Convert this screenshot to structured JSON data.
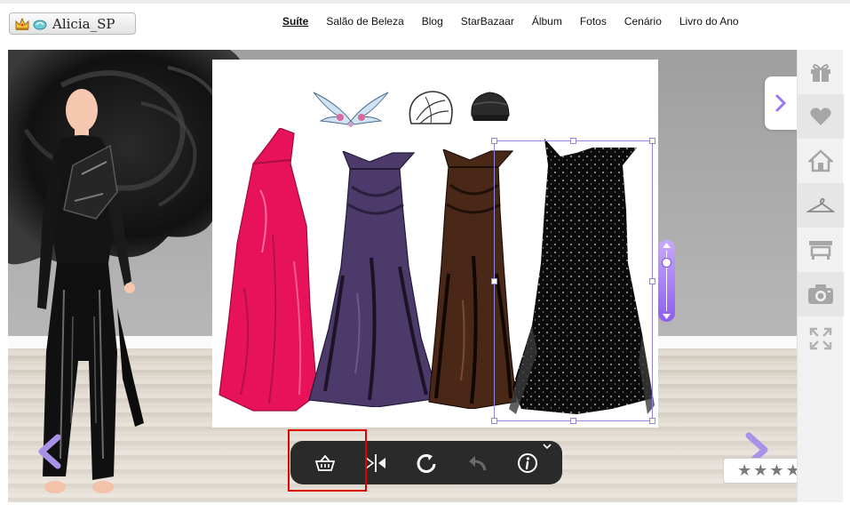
{
  "header": {
    "username": "Alicia_SP",
    "icons": [
      "crown-icon",
      "vip-badge-icon"
    ]
  },
  "nav": {
    "items": [
      "Suíte",
      "Salão de Beleza",
      "Blog",
      "StarBazaar",
      "Álbum",
      "Fotos",
      "Cenário",
      "Livro do Ano"
    ],
    "active": "Suíte"
  },
  "stage": {
    "items": [
      "wing-necklace",
      "white-headwrap",
      "black-cap",
      "pink-one-shoulder-gown",
      "purple-offshoulder-gown",
      "brown-offshoulder-gown",
      "black-sequin-gown"
    ],
    "selected_item": "black-sequin-gown"
  },
  "toolbar": {
    "tools": [
      "basket-icon",
      "flip-icon",
      "rotate-icon",
      "undo-icon",
      "info-icon"
    ],
    "highlighted_tool": "basket-icon"
  },
  "sidebar": {
    "buttons": [
      "gift-icon",
      "heart-icon",
      "home-icon",
      "hanger-icon",
      "store-icon",
      "camera-icon",
      "fullscreen-icon"
    ]
  },
  "rating": {
    "stars": 5,
    "filled": 0
  },
  "colors": {
    "accent_purple": "#9a78f0",
    "highlight_red": "#e00000",
    "toolbar_bg": "#2a2a2a",
    "pink_gown": "#e8125a",
    "purple_gown": "#4b3a6a",
    "brown_gown": "#4a2818"
  }
}
